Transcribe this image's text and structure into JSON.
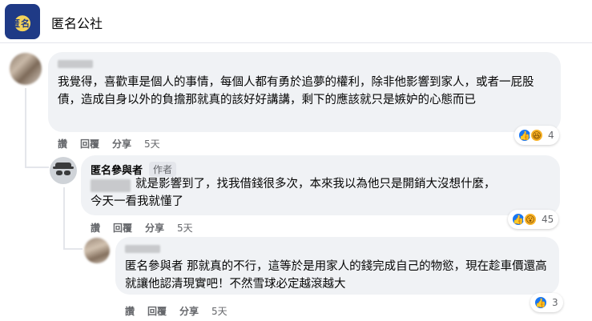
{
  "header": {
    "group_name": "匿名公社",
    "logo_text": "匿名"
  },
  "comments": [
    {
      "text": "我覺得，喜歡車是個人的事情，每個人都有勇於追夢的權利，除非他影響到家人，或者一屁股債，造成自身以外的負擔那就真的該好好講講，剩下的應該就只是嫉妒的心態而已",
      "actions": {
        "like": "讚",
        "reply": "回覆",
        "share": "分享",
        "time": "5天"
      },
      "reaction_count": "4"
    },
    {
      "author": "匿名參與者",
      "badge": "作者",
      "text_line1": "就是影響到了，找我借錢很多次，本來我以為他只是開銷大沒想什麼，",
      "text_line2": "今天一看我就懂了",
      "actions": {
        "like": "讚",
        "reply": "回覆",
        "share": "分享",
        "time": "5天"
      },
      "reaction_count": "45"
    },
    {
      "text": "匿名參與者 那就真的不行，這等於是用家人的錢完成自己的物慾，現在趁車價還高就讓他認清現實吧！不然雪球必定越滾越大",
      "actions": {
        "like": "讚",
        "reply": "回覆",
        "share": "分享",
        "time": "5天"
      },
      "reaction_count": "3"
    }
  ],
  "colors": {
    "bubble": "#f0f2f5",
    "like": "#1877f2",
    "meta": "#65676b"
  }
}
